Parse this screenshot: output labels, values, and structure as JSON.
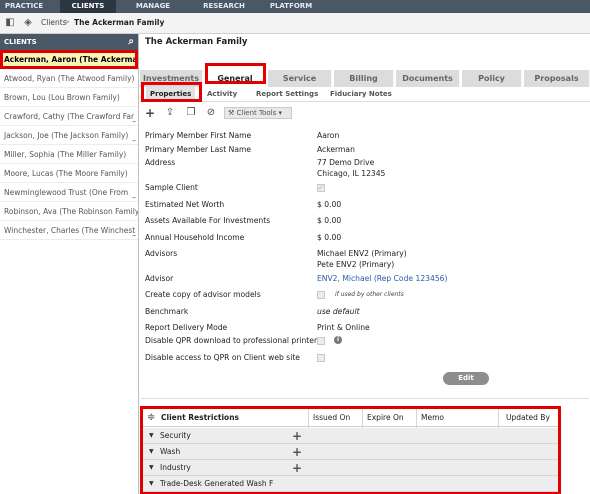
{
  "topnav": {
    "tabs": [
      "PRACTICE",
      "CLIENTS",
      "MANAGE",
      "RESEARCH",
      "PLATFORM"
    ],
    "active": "CLIENTS"
  },
  "breadcrumb": {
    "root": "Clients",
    "separator": ">",
    "current": "The Ackerman Family"
  },
  "sidebar": {
    "header": "CLIENTS",
    "items": [
      "Ackerman, Aaron (The Ackerma",
      "Atwood, Ryan (The Atwood Family)",
      "Brown, Lou (Lou Brown Family)",
      "Crawford, Cathy (The Crawford Far",
      "Jackson, Joe (The Jackson Family)",
      "Miller, Sophia (The Miller Family)",
      "Moore, Lucas (The Moore Family)",
      "Newminglewood Trust (One From",
      "Robinson, Ava (The Robinson Family)",
      "Winchester, Charles (The Winchest"
    ]
  },
  "main": {
    "title": "The Ackerman Family",
    "tabs": [
      "Investments",
      "General",
      "Service",
      "Billing",
      "Documents",
      "Policy",
      "Proposals"
    ],
    "active_tab": "General",
    "subtabs": [
      "Properties",
      "Activity",
      "Report Settings",
      "Fiduciary Notes"
    ],
    "active_subtab": "Properties",
    "client_tools": "Client Tools"
  },
  "properties": {
    "first_name_label": "Primary Member First Name",
    "first_name": "Aaron",
    "last_name_label": "Primary Member Last Name",
    "last_name": "Ackerman",
    "address_label": "Address",
    "address_line1": "77 Demo Drive",
    "address_line2": "Chicago, IL 12345",
    "sample_client_label": "Sample Client",
    "net_worth_label": "Estimated Net Worth",
    "net_worth": "$ 0.00",
    "assets_label": "Assets Available For Investments",
    "assets": "$ 0.00",
    "income_label": "Annual Household Income",
    "income": "$ 0.00",
    "advisors_label": "Advisors",
    "advisor_1": "Michael ENV2 (Primary)",
    "advisor_2": "Pete ENV2 (Primary)",
    "advisor_label": "Advisor",
    "advisor": "ENV2, Michael (Rep Code 123456)",
    "copy_models_label": "Create copy of advisor models",
    "copy_models_note": "if used by other clients",
    "benchmark_label": "Benchmark",
    "benchmark": "use default",
    "report_delivery_label": "Report Delivery Mode",
    "report_delivery": "Print & Online",
    "disable_qpr_label": "Disable QPR download to professional printer",
    "disable_web_label": "Disable access to QPR on Client web site",
    "edit_button": "Edit"
  },
  "restrictions": {
    "title": "Client Restrictions",
    "columns": [
      "Issued On",
      "Expire On",
      "Memo",
      "Updated By"
    ],
    "rows": [
      "Security",
      "Wash",
      "Industry",
      "Trade-Desk Generated Wash F"
    ]
  },
  "colors": {
    "nav_bg": "#4a5866",
    "highlight_red": "#e00000",
    "selected_bg": "#fbf6b7",
    "link": "#2a5aa6"
  }
}
